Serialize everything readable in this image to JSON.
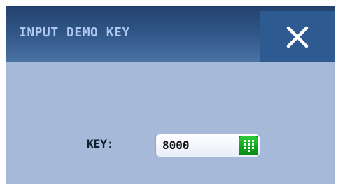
{
  "dialog": {
    "title": "INPUT DEMO KEY",
    "close_icon": "close-icon"
  },
  "form": {
    "key_label": "KEY:",
    "key_value": "8000",
    "keypad_icon": "keypad-icon"
  },
  "colors": {
    "title_text": "#aec6f0",
    "titlebar": "#2f5585",
    "close_button": "#2e5a92",
    "body_bg": "#a6b9d9",
    "keypad_button": "#14a321"
  }
}
